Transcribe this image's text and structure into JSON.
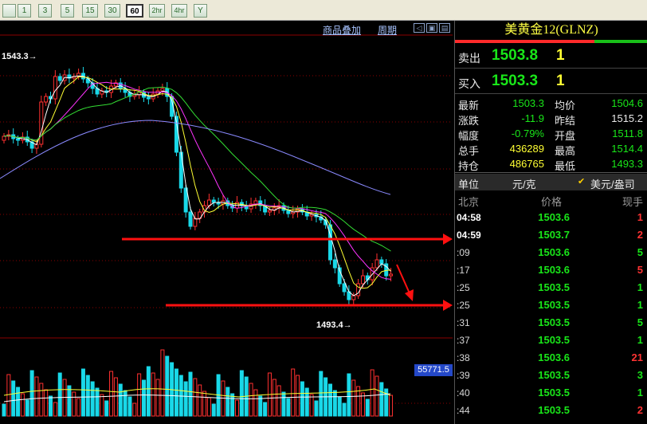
{
  "toolbar": {
    "periods": [
      "1",
      "3",
      "5",
      "15",
      "30",
      "60",
      "2hr",
      "4hr",
      "Y"
    ],
    "active_period": "60"
  },
  "chart": {
    "link_overlay": "商品叠加",
    "link_period": "周期",
    "high_label": "1543.3",
    "low_label": "1493.4",
    "volume_label": "55771.5",
    "arrows": "red trend arrows"
  },
  "quote": {
    "title": "美黄金12(GLNZ)",
    "sell_label": "卖出",
    "sell_price": "1503.8",
    "sell_vol": "1",
    "buy_label": "买入",
    "buy_price": "1503.3",
    "buy_vol": "1"
  },
  "stats": [
    {
      "l1": "最新",
      "v1": "1503.3",
      "c1": "#19e619",
      "l2": "均价",
      "v2": "1504.6",
      "c2": "#19e619"
    },
    {
      "l1": "涨跌",
      "v1": "-11.9",
      "c1": "#19e619",
      "l2": "昨结",
      "v2": "1515.2",
      "c2": "#e8e8e8"
    },
    {
      "l1": "幅度",
      "v1": "-0.79%",
      "c1": "#19e619",
      "l2": "开盘",
      "v2": "1511.8",
      "c2": "#19e619"
    },
    {
      "l1": "总手",
      "v1": "436289",
      "c1": "#ffff33",
      "l2": "最高",
      "v2": "1514.4",
      "c2": "#19e619"
    },
    {
      "l1": "持仓",
      "v1": "486765",
      "c1": "#ffff33",
      "l2": "最低",
      "v2": "1493.3",
      "c2": "#19e619"
    }
  ],
  "unit": {
    "label": "单位",
    "yuan": "元/克",
    "usd": "美元/盎司",
    "check": "✔"
  },
  "ticks_header": {
    "time": "北京",
    "price": "价格",
    "vol": "现手"
  },
  "ticks": [
    {
      "time": "04:58",
      "price": "1503.6",
      "vol": "1",
      "vc": "#ff3333",
      "bold": true
    },
    {
      "time": "04:59",
      "price": "1503.7",
      "vol": "2",
      "vc": "#ff3333",
      "bold": true
    },
    {
      "time": ":09",
      "price": "1503.6",
      "vol": "5",
      "vc": "#19e619",
      "bold": false
    },
    {
      "time": ":17",
      "price": "1503.6",
      "vol": "5",
      "vc": "#ff3333",
      "bold": false
    },
    {
      "time": ":25",
      "price": "1503.5",
      "vol": "1",
      "vc": "#19e619",
      "bold": false
    },
    {
      "time": ":25",
      "price": "1503.5",
      "vol": "1",
      "vc": "#19e619",
      "bold": false
    },
    {
      "time": ":31",
      "price": "1503.5",
      "vol": "5",
      "vc": "#19e619",
      "bold": false
    },
    {
      "time": ":37",
      "price": "1503.5",
      "vol": "1",
      "vc": "#19e619",
      "bold": false
    },
    {
      "time": ":38",
      "price": "1503.6",
      "vol": "21",
      "vc": "#ff3333",
      "bold": false
    },
    {
      "time": ":39",
      "price": "1503.5",
      "vol": "3",
      "vc": "#19e619",
      "bold": false
    },
    {
      "time": ":40",
      "price": "1503.5",
      "vol": "1",
      "vc": "#19e619",
      "bold": false
    },
    {
      "time": ":44",
      "price": "1503.5",
      "vol": "2",
      "vc": "#ff3333",
      "bold": false
    }
  ]
}
